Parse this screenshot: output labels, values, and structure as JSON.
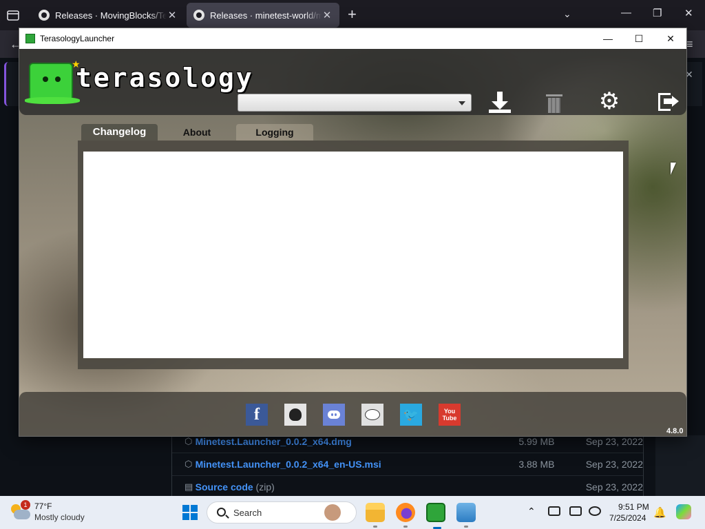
{
  "browser": {
    "tabs": [
      {
        "title": "Releases · MovingBlocks/Terasology",
        "active": false
      },
      {
        "title": "Releases · minetest-world/mtlauncher",
        "active": true
      }
    ],
    "new_tab_label": "+",
    "close_glyph": "✕",
    "back_glyph": "←",
    "menu_glyph": "≡"
  },
  "github": {
    "assets": [
      {
        "name": "Minetest.Launcher_0.0.2_x64.dmg",
        "size": "5.99 MB",
        "date": "Sep 23, 2022",
        "icon": "package-icon"
      },
      {
        "name": "Minetest.Launcher_0.0.2_x64_en-US.msi",
        "size": "3.88 MB",
        "date": "Sep 23, 2022",
        "icon": "package-icon"
      },
      {
        "name": "Source code",
        "suffix": "(zip)",
        "size": "",
        "date": "Sep 23, 2022",
        "icon": "file-zip-icon"
      }
    ]
  },
  "launcher": {
    "window_title": "TerasologyLauncher",
    "logo_text": "terasology",
    "version_select_value": "",
    "header_buttons": [
      {
        "name": "download-icon",
        "enabled": true
      },
      {
        "name": "trash-icon",
        "enabled": false
      },
      {
        "name": "settings-gear-icon",
        "enabled": true
      },
      {
        "name": "exit-icon",
        "enabled": true
      }
    ],
    "tabs": [
      {
        "label": "Changelog",
        "active": true
      },
      {
        "label": "About",
        "active": false
      },
      {
        "label": "Logging",
        "active": false
      }
    ],
    "social_links": [
      {
        "name": "facebook",
        "glyph": "f",
        "color": "#3b5998"
      },
      {
        "name": "github",
        "color": "#e5e5e5"
      },
      {
        "name": "discord",
        "color": "#6a82d6"
      },
      {
        "name": "reddit",
        "color": "#e0e0e0"
      },
      {
        "name": "twitter",
        "glyph": "🐦",
        "color": "#2aa9e0"
      },
      {
        "name": "youtube",
        "glyph_top": "You",
        "glyph_bottom": "Tube",
        "color": "#d83a2e"
      }
    ],
    "version": "4.8.0"
  },
  "taskbar": {
    "weather": {
      "badge": "1",
      "temp": "77°F",
      "desc": "Mostly cloudy"
    },
    "search_placeholder": "Search",
    "clock": {
      "time": "9:51 PM",
      "date": "7/25/2024"
    }
  }
}
